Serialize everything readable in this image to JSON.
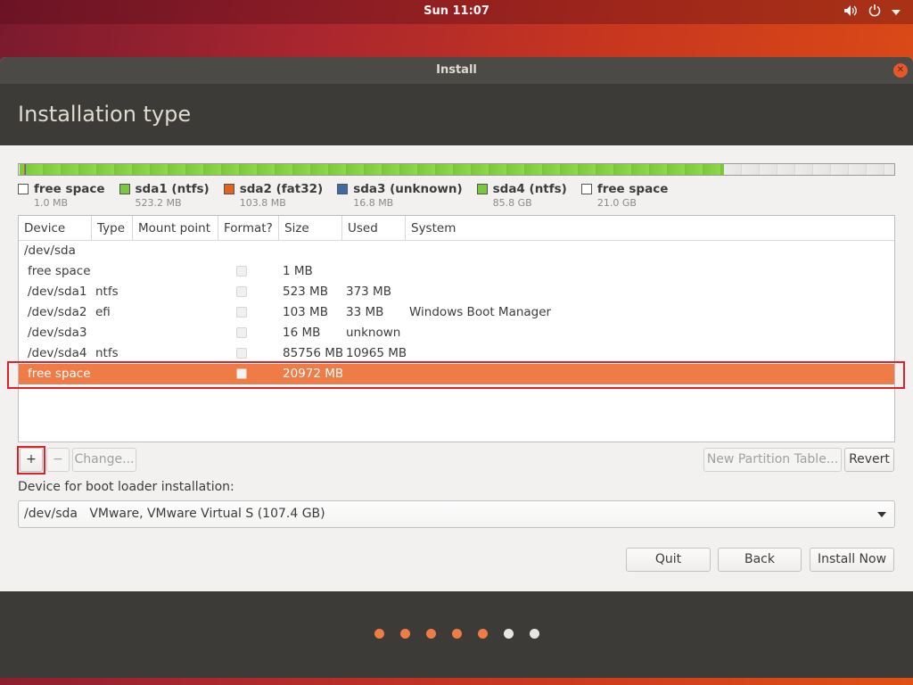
{
  "topbar": {
    "clock": "Sun 11:07",
    "volume_icon": "volume-icon",
    "power_icon": "power-icon",
    "menu_icon": "chevron-down-icon"
  },
  "window": {
    "title": "Install",
    "close_icon": "close-icon"
  },
  "header": {
    "title": "Installation type"
  },
  "colors": {
    "accent": "#ef7b46",
    "ntfs": "#7cc83c",
    "fat32": "#e0651c",
    "unknown": "#3f6aa6",
    "free": "#ececec",
    "highlight": "#e0202a"
  },
  "disk_bar": {
    "segments": [
      {
        "name": "free space",
        "fraction": 1e-05,
        "color": "gray"
      },
      {
        "name": "sda1",
        "fraction": 0.0049,
        "color": "green"
      },
      {
        "name": "sda2",
        "fraction": 0.00097,
        "color": "orange"
      },
      {
        "name": "sda3",
        "fraction": 0.00016,
        "color": "blue"
      },
      {
        "name": "sda4",
        "fraction": 0.7988,
        "color": "green"
      },
      {
        "name": "free space",
        "fraction": 0.1953,
        "color": "gray"
      }
    ]
  },
  "legend": [
    {
      "name": "free space",
      "size": "1.0 MB",
      "color": "#ffffff"
    },
    {
      "name": "sda1 (ntfs)",
      "size": "523.2 MB",
      "color": "#7cc83c"
    },
    {
      "name": "sda2 (fat32)",
      "size": "103.8 MB",
      "color": "#e0651c"
    },
    {
      "name": "sda3 (unknown)",
      "size": "16.8 MB",
      "color": "#3f6aa6"
    },
    {
      "name": "sda4 (ntfs)",
      "size": "85.8 GB",
      "color": "#7cc83c"
    },
    {
      "name": "free space",
      "size": "21.0 GB",
      "color": "#ffffff"
    }
  ],
  "table": {
    "columns": [
      "Device",
      "Type",
      "Mount point",
      "Format?",
      "Size",
      "Used",
      "System"
    ],
    "group": "/dev/sda",
    "rows": [
      {
        "device": "free space",
        "type": "",
        "mount": "",
        "format": false,
        "size": "1 MB",
        "used": "",
        "system": ""
      },
      {
        "device": "/dev/sda1",
        "type": "ntfs",
        "mount": "",
        "format": false,
        "size": "523 MB",
        "used": "373 MB",
        "system": ""
      },
      {
        "device": "/dev/sda2",
        "type": "efi",
        "mount": "",
        "format": false,
        "size": "103 MB",
        "used": "33 MB",
        "system": "Windows Boot Manager"
      },
      {
        "device": "/dev/sda3",
        "type": "",
        "mount": "",
        "format": false,
        "size": "16 MB",
        "used": "unknown",
        "system": ""
      },
      {
        "device": "/dev/sda4",
        "type": "ntfs",
        "mount": "",
        "format": false,
        "size": "85756 MB",
        "used": "10965 MB",
        "system": ""
      },
      {
        "device": "free space",
        "type": "",
        "mount": "",
        "format": false,
        "size": "20972 MB",
        "used": "",
        "system": "",
        "selected": true
      }
    ]
  },
  "toolbar": {
    "add_label": "+",
    "remove_label": "−",
    "change_label": "Change...",
    "new_table_label": "New Partition Table...",
    "revert_label": "Revert"
  },
  "bootloader": {
    "label": "Device for boot loader installation:",
    "selected": "/dev/sda   VMware, VMware Virtual S (107.4 GB)"
  },
  "actions": {
    "quit_label": "Quit",
    "back_label": "Back",
    "install_label": "Install Now"
  },
  "progress": {
    "completed_steps": 5,
    "total_steps": 7
  }
}
